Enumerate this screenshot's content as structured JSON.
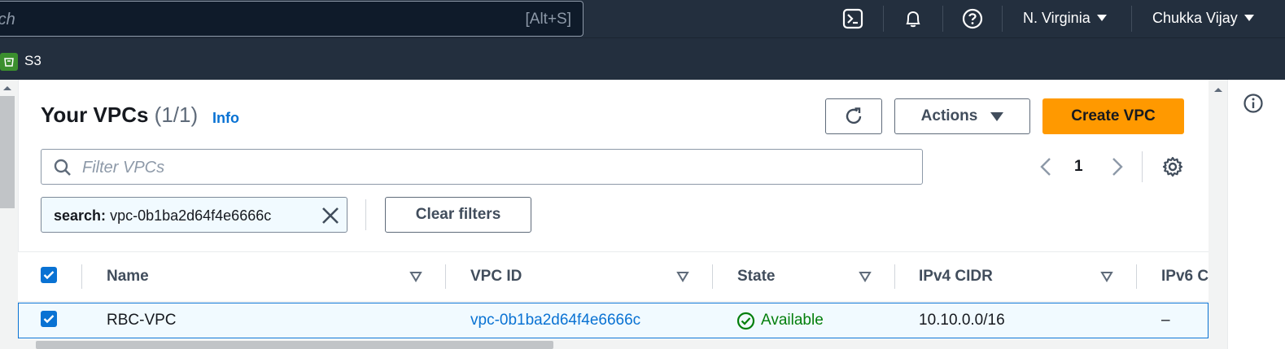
{
  "topnav": {
    "search_placeholder": "rch",
    "search_shortcut": "[Alt+S]",
    "region": "N. Virginia",
    "user": "Chukka Vijay",
    "icons": [
      "cloudshell-icon",
      "bell-icon",
      "help-icon"
    ]
  },
  "servicebar": {
    "service_label": "S3"
  },
  "page": {
    "title": "Your VPCs",
    "count": "(1/1)",
    "info_label": "Info"
  },
  "toolbar": {
    "actions_label": "Actions",
    "create_label": "Create VPC"
  },
  "filter": {
    "placeholder": "Filter VPCs",
    "token_key": "search:",
    "token_value": "vpc-0b1ba2d64f4e6666c",
    "clear_label": "Clear filters"
  },
  "pagination": {
    "current_page": "1"
  },
  "table": {
    "columns": [
      "Name",
      "VPC ID",
      "State",
      "IPv4 CIDR",
      "IPv6 C"
    ],
    "rows": [
      {
        "name": "RBC-VPC",
        "vpc_id": "vpc-0b1ba2d64f4e6666c",
        "state": "Available",
        "ipv4_cidr": "10.10.0.0/16",
        "ipv6": "–"
      }
    ]
  },
  "colors": {
    "nav_bg": "#232f3e",
    "primary": "#ff9900",
    "link": "#0972d3",
    "success": "#037f0c"
  }
}
